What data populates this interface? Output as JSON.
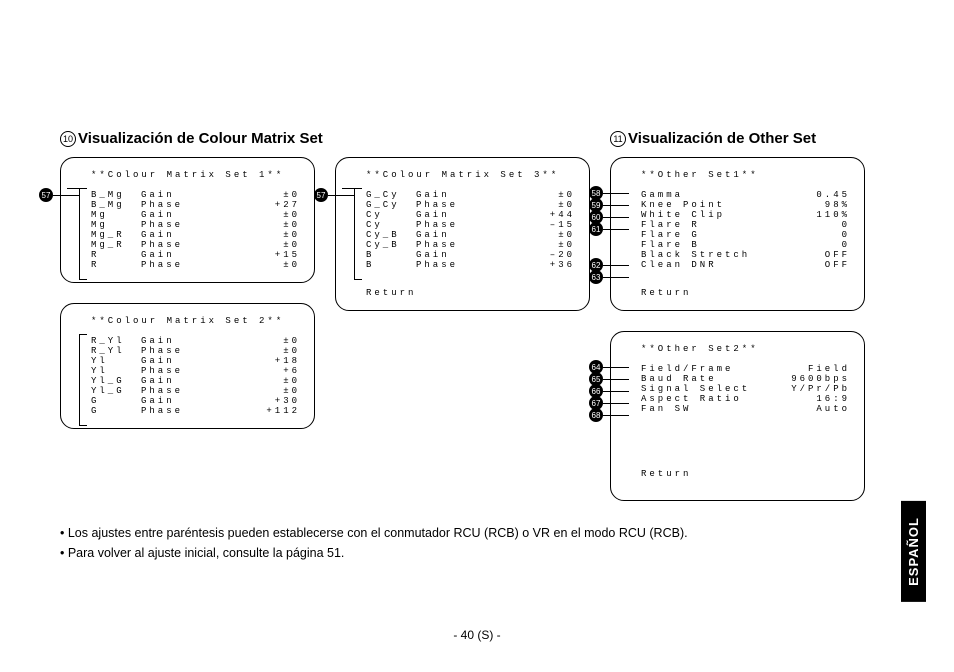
{
  "headings": {
    "left_num": "10",
    "left_text": "Visualización de Colour Matrix Set",
    "right_num": "11",
    "right_text": "Visualización de Other Set"
  },
  "panels": {
    "cm1": {
      "title": "**Colour Matrix Set 1**",
      "rows": [
        {
          "l": "B_Mg",
          "p": "Gain",
          "v": "±0"
        },
        {
          "l": "B_Mg",
          "p": "Phase",
          "v": "+27"
        },
        {
          "l": "Mg",
          "p": "Gain",
          "v": "±0"
        },
        {
          "l": "Mg",
          "p": "Phase",
          "v": "±0"
        },
        {
          "l": "Mg_R",
          "p": "Gain",
          "v": "±0"
        },
        {
          "l": "Mg_R",
          "p": "Phase",
          "v": "±0"
        },
        {
          "l": "R",
          "p": "Gain",
          "v": "+15"
        },
        {
          "l": "R",
          "p": "Phase",
          "v": "±0"
        }
      ],
      "marker": "57"
    },
    "cm2": {
      "title": "**Colour Matrix Set 2**",
      "rows": [
        {
          "l": "R_Yl",
          "p": "Gain",
          "v": "±0"
        },
        {
          "l": "R_Yl",
          "p": "Phase",
          "v": "±0"
        },
        {
          "l": "Yl",
          "p": "Gain",
          "v": "+18"
        },
        {
          "l": "Yl",
          "p": "Phase",
          "v": "+6"
        },
        {
          "l": "Yl_G",
          "p": "Gain",
          "v": "±0"
        },
        {
          "l": "Yl_G",
          "p": "Phase",
          "v": "±0"
        },
        {
          "l": "G",
          "p": "Gain",
          "v": "+30"
        },
        {
          "l": "G",
          "p": "Phase",
          "v": "+112"
        }
      ]
    },
    "cm3": {
      "title": "**Colour Matrix Set 3**",
      "rows": [
        {
          "l": "G_Cy",
          "p": "Gain",
          "v": "±0"
        },
        {
          "l": "G_Cy",
          "p": "Phase",
          "v": "±0"
        },
        {
          "l": "Cy",
          "p": "Gain",
          "v": "+44"
        },
        {
          "l": "Cy",
          "p": "Phase",
          "v": "–15"
        },
        {
          "l": "Cy_B",
          "p": "Gain",
          "v": "±0"
        },
        {
          "l": "Cy_B",
          "p": "Phase",
          "v": "±0"
        },
        {
          "l": "B",
          "p": "Gain",
          "v": "–20"
        },
        {
          "l": "B",
          "p": "Phase",
          "v": "+36"
        }
      ],
      "return": "Return",
      "marker": "57"
    },
    "os1": {
      "title": "**Other Set1**",
      "rows": [
        {
          "l": "Gamma",
          "v": "0.45",
          "m": "58"
        },
        {
          "l": "Knee Point",
          "v": "98%",
          "m": "59"
        },
        {
          "l": "White Clip",
          "v": "110%",
          "m": "60"
        },
        {
          "l": "Flare R",
          "v": "0",
          "m": "61"
        },
        {
          "l": "Flare G",
          "v": "0"
        },
        {
          "l": "Flare B",
          "v": "0"
        },
        {
          "l": "Black Stretch",
          "v": "OFF",
          "m": "62"
        },
        {
          "l": "Clean DNR",
          "v": "OFF",
          "m": "63"
        }
      ],
      "return": "Return"
    },
    "os2": {
      "title": "**Other Set2**",
      "rows": [
        {
          "l": "Field/Frame",
          "v": "Field",
          "m": "64"
        },
        {
          "l": "Baud Rate",
          "v": "9600bps",
          "m": "65"
        },
        {
          "l": "Signal Select",
          "v": "Y/Pr/Pb",
          "m": "66"
        },
        {
          "l": "Aspect Ratio",
          "v": "16:9",
          "m": "67"
        },
        {
          "l": "Fan SW",
          "v": "Auto",
          "m": "68"
        }
      ],
      "return": "Return"
    }
  },
  "common": {
    "return": "Return"
  },
  "notes": {
    "line1": "• Los ajustes entre paréntesis pueden establecerse con el conmutador RCU (RCB) o VR en el modo RCU (RCB).",
    "line2": "• Para volver al ajuste inicial, consulte la página 51."
  },
  "footer": "- 40 (S) -",
  "side_tab": "ESPAÑOL"
}
